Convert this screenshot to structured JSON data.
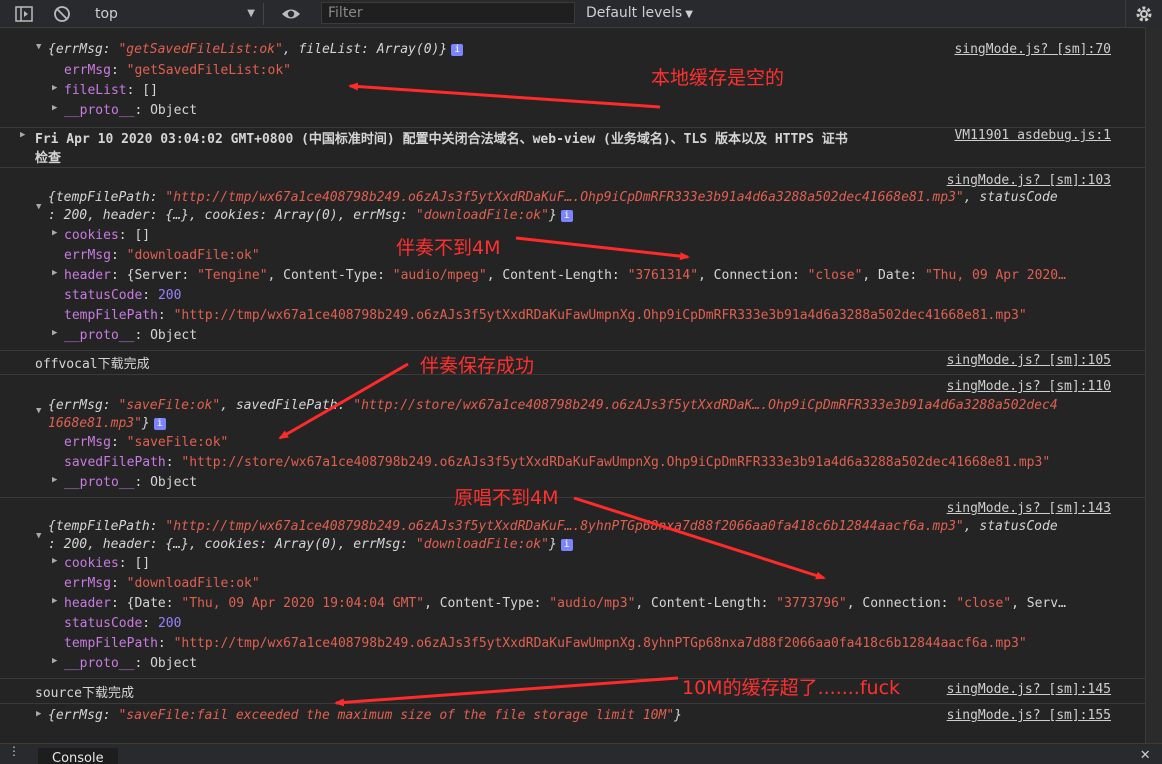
{
  "toolbar": {
    "context": "top",
    "filter_placeholder": "Filter",
    "levels": "Default levels"
  },
  "annotations": {
    "a1": "本地缓存是空的",
    "a2": "伴奏不到4M",
    "a3": "伴奏保存成功",
    "a4": "原唱不到4M",
    "a5": "10M的缓存超了.......fuck"
  },
  "logs": {
    "m1": {
      "source": "singMode.js? [sm]:70",
      "head_p1": "{errMsg: ",
      "head_v1": "\"getSavedFileList:ok\"",
      "head_p2": ", fileList: ",
      "head_v2": "Array(0)",
      "head_p3": "}",
      "l1_key": "errMsg",
      "l1_val": "\"getSavedFileList:ok\"",
      "l2_key": "fileList",
      "l2_val": "[]",
      "l3_key": "__proto__",
      "l3_val": "Object"
    },
    "m2": {
      "text1": "Fri Apr 10 2020 03:04:02 GMT+0800 (中国标准时间) 配置中关闭合法域名、web-view (业务域名)、TLS 版本以及 HTTPS 证书",
      "text2": "检查",
      "source": "VM11901 asdebug.js:1"
    },
    "m3": {
      "source": "singMode.js? [sm]:103",
      "h1_p1": "{tempFilePath: ",
      "h1_v1": "\"http://tmp/wx67a1ce408798b249.o6zAJs3f5ytXxdRDaKuF….Ohp9iCpDmRFR333e3b91a4d6a3288a502dec41668e81.mp3\"",
      "h1_p2": ", statusCode",
      "h2_p1": ": ",
      "h2_v1": "200",
      "h2_p2": ", header: {…}, cookies: ",
      "h2_v2": "Array(0)",
      "h2_p3": ", errMsg: ",
      "h2_v3": "\"downloadFile:ok\"",
      "h2_p4": "}",
      "l1_key": "cookies",
      "l1_val": "[]",
      "l2_key": "errMsg",
      "l2_val": "\"downloadFile:ok\"",
      "l3_key": "header",
      "l3_a": "{Server: ",
      "l3_b": "\"Tengine\"",
      "l3_c": ", Content-Type: ",
      "l3_d": "\"audio/mpeg\"",
      "l3_e": ", Content-Length: ",
      "l3_f": "\"3761314\"",
      "l3_g": ", Connection: ",
      "l3_h": "\"close\"",
      "l3_i": ", Date: ",
      "l3_j": "\"Thu, 09 Apr 2020…",
      "l4_key": "statusCode",
      "l4_val": "200",
      "l5_key": "tempFilePath",
      "l5_val": "\"http://tmp/wx67a1ce408798b249.o6zAJs3f5ytXxdRDaKuFawUmpnXg.Ohp9iCpDmRFR333e3b91a4d6a3288a502dec41668e81.mp3\"",
      "l6_key": "__proto__",
      "l6_val": "Object"
    },
    "m4": {
      "text": "offvocal下载完成",
      "source": "singMode.js? [sm]:105"
    },
    "m5": {
      "source": "singMode.js? [sm]:110",
      "h1_p1": "{errMsg: ",
      "h1_v1": "\"saveFile:ok\"",
      "h1_p2": ", savedFilePath: ",
      "h1_v2": "\"http://store/wx67a1ce408798b249.o6zAJs3f5ytXxdRDaK….Ohp9iCpDmRFR333e3b91a4d6a3288a502dec4",
      "h2_v1": "1668e81.mp3\"",
      "h2_p1": "}",
      "l1_key": "errMsg",
      "l1_val": "\"saveFile:ok\"",
      "l2_key": "savedFilePath",
      "l2_val": "\"http://store/wx67a1ce408798b249.o6zAJs3f5ytXxdRDaKuFawUmpnXg.Ohp9iCpDmRFR333e3b91a4d6a3288a502dec41668e81.mp3\"",
      "l3_key": "__proto__",
      "l3_val": "Object"
    },
    "m6": {
      "source": "singMode.js? [sm]:143",
      "h1_p1": "{tempFilePath: ",
      "h1_v1": "\"http://tmp/wx67a1ce408798b249.o6zAJs3f5ytXxdRDaKuF….8yhnPTGp68nxa7d88f2066aa0fa418c6b12844aacf6a.mp3\"",
      "h1_p2": ", statusCode",
      "h2_p1": ": ",
      "h2_v1": "200",
      "h2_p2": ", header: {…}, cookies: ",
      "h2_v2": "Array(0)",
      "h2_p3": ", errMsg: ",
      "h2_v3": "\"downloadFile:ok\"",
      "h2_p4": "}",
      "l1_key": "cookies",
      "l1_val": "[]",
      "l2_key": "errMsg",
      "l2_val": "\"downloadFile:ok\"",
      "l3_key": "header",
      "l3_a": "{Date: ",
      "l3_b": "\"Thu, 09 Apr 2020 19:04:04 GMT\"",
      "l3_c": ", Content-Type: ",
      "l3_d": "\"audio/mp3\"",
      "l3_e": ", Content-Length: ",
      "l3_f": "\"3773796\"",
      "l3_g": ", Connection: ",
      "l3_h": "\"close\"",
      "l3_i": ", Serv…",
      "l4_key": "statusCode",
      "l4_val": "200",
      "l5_key": "tempFilePath",
      "l5_val": "\"http://tmp/wx67a1ce408798b249.o6zAJs3f5ytXxdRDaKuFawUmpnXg.8yhnPTGp68nxa7d88f2066aa0fa418c6b12844aacf6a.mp3\"",
      "l6_key": "__proto__",
      "l6_val": "Object"
    },
    "m7": {
      "text": "source下载完成",
      "source": "singMode.js? [sm]:145"
    },
    "m8": {
      "p1": "{errMsg: ",
      "v1": "\"saveFile:fail exceeded the maximum size of the file storage limit 10M\"",
      "p2": "}",
      "source": "singMode.js? [sm]:155"
    }
  },
  "bottom": {
    "tab": "Console"
  }
}
